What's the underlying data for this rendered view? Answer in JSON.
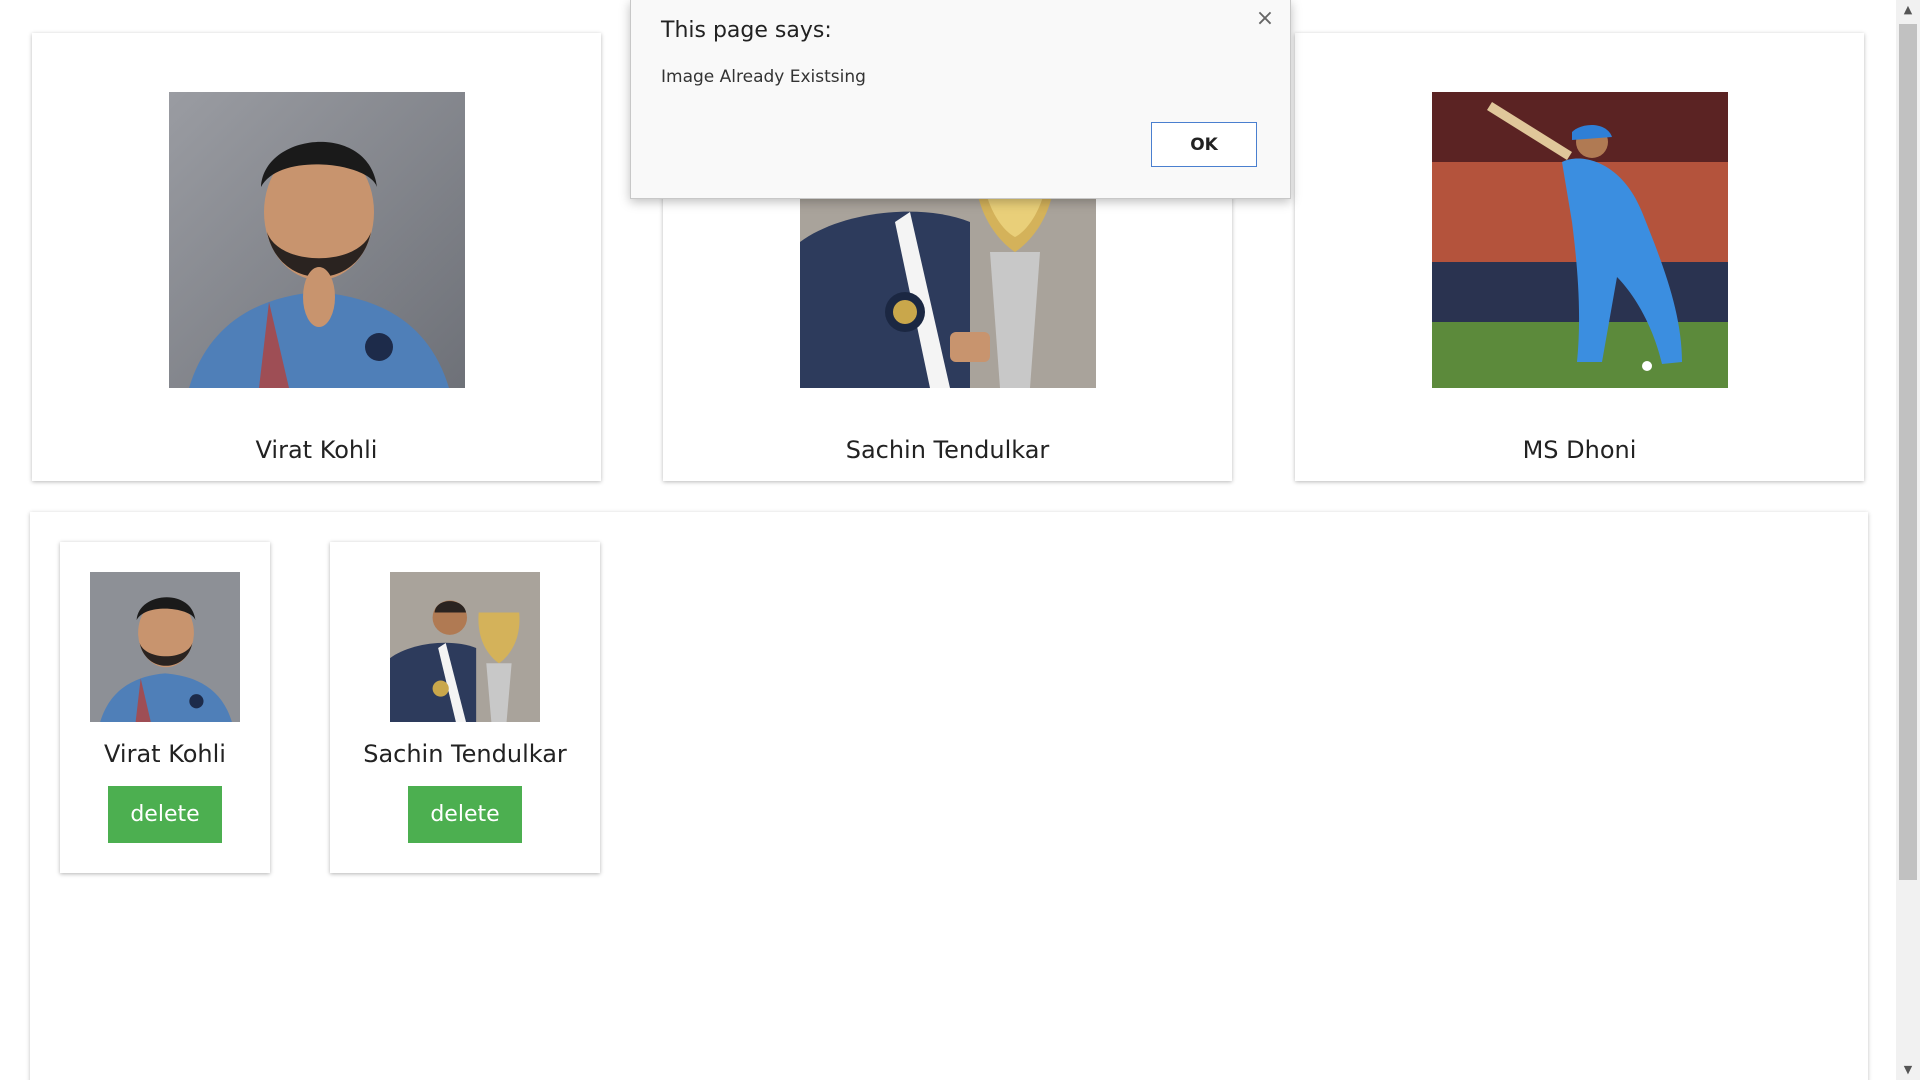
{
  "gallery": {
    "cards": [
      {
        "name": "Virat Kohli"
      },
      {
        "name": "Sachin Tendulkar"
      },
      {
        "name": "MS Dhoni"
      }
    ]
  },
  "selected": {
    "items": [
      {
        "name": "Virat Kohli",
        "delete_label": "delete"
      },
      {
        "name": "Sachin Tendulkar",
        "delete_label": "delete"
      }
    ]
  },
  "dialog": {
    "title": "This page says:",
    "message": "Image Already Existsing",
    "ok_label": "OK",
    "close_glyph": "×"
  },
  "colors": {
    "delete_button": "#4caf50",
    "ok_border": "#4a7fcf"
  }
}
